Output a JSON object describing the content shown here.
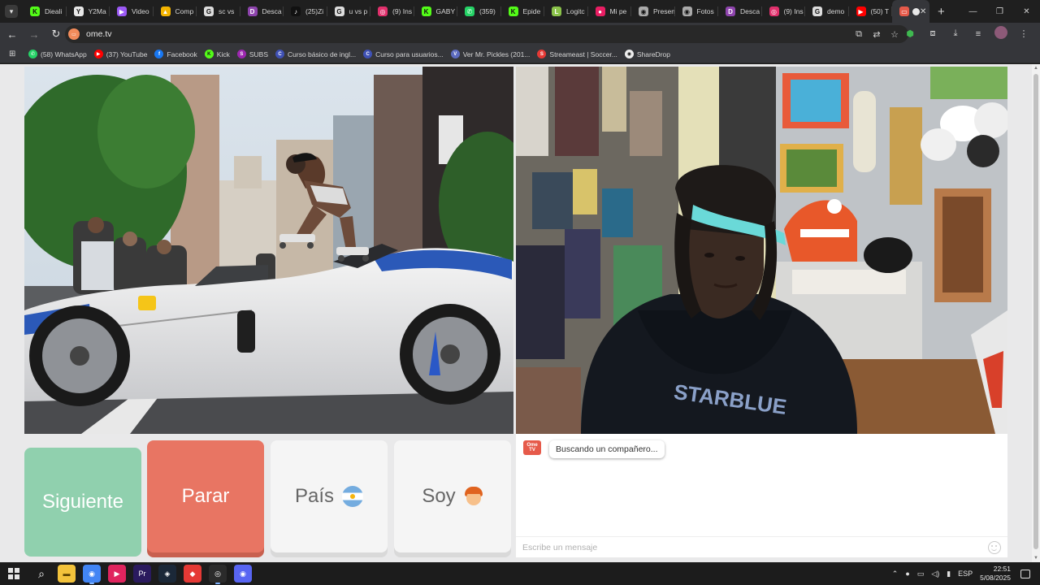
{
  "browser": {
    "tabs": [
      {
        "label": "Dieali",
        "favicon": "kick-icon",
        "color": "#53fc18",
        "glyph": "K"
      },
      {
        "label": "Y2Ma",
        "favicon": "y2mate-icon",
        "color": "#e8e8e8",
        "glyph": "Y"
      },
      {
        "label": "Video",
        "favicon": "video-icon",
        "color": "#9b59f5",
        "glyph": "▶"
      },
      {
        "label": "Comp",
        "favicon": "drive-icon",
        "color": "#f4b400",
        "glyph": "▲"
      },
      {
        "label": "sc vs",
        "favicon": "google-icon",
        "color": "#dddddd",
        "glyph": "G"
      },
      {
        "label": "Desca",
        "favicon": "download-site-icon",
        "color": "#8e44ad",
        "glyph": "D"
      },
      {
        "label": "(25)Zi",
        "favicon": "tiktok-icon",
        "color": "#111111",
        "glyph": "♪"
      },
      {
        "label": "u vs p",
        "favicon": "google-icon",
        "color": "#dddddd",
        "glyph": "G"
      },
      {
        "label": "(9) Ins",
        "favicon": "instagram-icon",
        "color": "#e1306c",
        "glyph": "◎"
      },
      {
        "label": "GABY",
        "favicon": "kick-icon",
        "color": "#53fc18",
        "glyph": "K"
      },
      {
        "label": "(359)",
        "favicon": "whatsapp-icon",
        "color": "#25d366",
        "glyph": "✆"
      },
      {
        "label": "Epide",
        "favicon": "kick-icon",
        "color": "#53fc18",
        "glyph": "K"
      },
      {
        "label": "Logitc",
        "favicon": "logitech-icon",
        "color": "#8bc34a",
        "glyph": "L"
      },
      {
        "label": "Mi pe",
        "favicon": "profile-icon",
        "color": "#e91e63",
        "glyph": "●"
      },
      {
        "label": "Presen",
        "favicon": "present-icon",
        "color": "#aaaaaa",
        "glyph": "◉"
      },
      {
        "label": "Fotos",
        "favicon": "photos-icon",
        "color": "#aaaaaa",
        "glyph": "◉"
      },
      {
        "label": "Desca",
        "favicon": "download-site-icon",
        "color": "#8e44ad",
        "glyph": "D"
      },
      {
        "label": "(9) Ins",
        "favicon": "instagram-icon",
        "color": "#e1306c",
        "glyph": "◎"
      },
      {
        "label": "demo",
        "favicon": "google-icon",
        "color": "#dddddd",
        "glyph": "G"
      },
      {
        "label": "(50) T",
        "favicon": "youtube-icon",
        "color": "#ff0000",
        "glyph": "▶"
      }
    ],
    "active_tab": {
      "favicon": "ometv-icon",
      "color": "#e65a4a"
    },
    "new_tab_label": "+",
    "url": "ome.tv",
    "bookmarks": [
      {
        "label": "(58) WhatsApp",
        "icon": "whatsapp-icon",
        "color": "#25d366",
        "glyph": "✆"
      },
      {
        "label": "(37) YouTube",
        "icon": "youtube-icon",
        "color": "#ff0000",
        "glyph": "▶"
      },
      {
        "label": "Facebook",
        "icon": "facebook-icon",
        "color": "#1877f2",
        "glyph": "f"
      },
      {
        "label": "Kick",
        "icon": "kick-icon",
        "color": "#53fc18",
        "glyph": "K"
      },
      {
        "label": "SUBS",
        "icon": "subs-icon",
        "color": "#9c27b0",
        "glyph": "S"
      },
      {
        "label": "Curso básico de ingl...",
        "icon": "course-icon",
        "color": "#3f51b5",
        "glyph": "C"
      },
      {
        "label": "Curso para usuarios...",
        "icon": "course-icon",
        "color": "#3f51b5",
        "glyph": "C"
      },
      {
        "label": "Ver Mr. Pickles (201...",
        "icon": "pickles-icon",
        "color": "#5c6bc0",
        "glyph": "V"
      },
      {
        "label": "Streameast | Soccer...",
        "icon": "streameast-icon",
        "color": "#e53935",
        "glyph": "S"
      },
      {
        "label": "ShareDrop",
        "icon": "sharedrop-icon",
        "color": "#eeeeee",
        "glyph": "◉"
      }
    ]
  },
  "ometv": {
    "buttons": {
      "next": "Siguiente",
      "stop": "Parar",
      "country": "País",
      "iam": "Soy"
    },
    "logo_text": "Ome TV",
    "chat_status": "Buscando un compañero...",
    "chat_placeholder": "Escribe un mensaje",
    "colors": {
      "next": "#90d0ae",
      "stop": "#e87563",
      "neutral": "#f5f5f5"
    }
  },
  "taskbar": {
    "apps": [
      {
        "name": "file-explorer-icon",
        "color": "#f3c33b",
        "glyph": "▬"
      },
      {
        "name": "chrome-icon",
        "color": "#4285f4",
        "glyph": "◉",
        "active": true
      },
      {
        "name": "media-player-icon",
        "color": "#e0245e",
        "glyph": "▶"
      },
      {
        "name": "premiere-icon",
        "color": "#2a1a5e",
        "glyph": "Pr"
      },
      {
        "name": "steam-icon",
        "color": "#1b2838",
        "glyph": "◈"
      },
      {
        "name": "capcut-icon",
        "color": "#e53935",
        "glyph": "◆"
      },
      {
        "name": "obs-icon",
        "color": "#2b2b2b",
        "glyph": "◎",
        "active": true
      },
      {
        "name": "discord-icon",
        "color": "#5865f2",
        "glyph": "◉"
      }
    ],
    "lang": "ESP",
    "time": "22:51",
    "date": "5/08/2025"
  }
}
